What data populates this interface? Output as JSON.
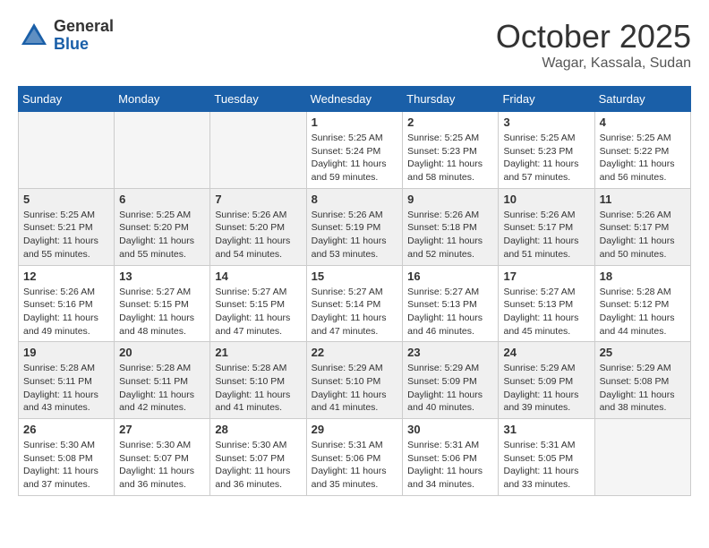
{
  "logo": {
    "general": "General",
    "blue": "Blue"
  },
  "title": "October 2025",
  "location": "Wagar, Kassala, Sudan",
  "days_header": [
    "Sunday",
    "Monday",
    "Tuesday",
    "Wednesday",
    "Thursday",
    "Friday",
    "Saturday"
  ],
  "weeks": [
    [
      {
        "day": "",
        "info": ""
      },
      {
        "day": "",
        "info": ""
      },
      {
        "day": "",
        "info": ""
      },
      {
        "day": "1",
        "info": "Sunrise: 5:25 AM\nSunset: 5:24 PM\nDaylight: 11 hours\nand 59 minutes."
      },
      {
        "day": "2",
        "info": "Sunrise: 5:25 AM\nSunset: 5:23 PM\nDaylight: 11 hours\nand 58 minutes."
      },
      {
        "day": "3",
        "info": "Sunrise: 5:25 AM\nSunset: 5:23 PM\nDaylight: 11 hours\nand 57 minutes."
      },
      {
        "day": "4",
        "info": "Sunrise: 5:25 AM\nSunset: 5:22 PM\nDaylight: 11 hours\nand 56 minutes."
      }
    ],
    [
      {
        "day": "5",
        "info": "Sunrise: 5:25 AM\nSunset: 5:21 PM\nDaylight: 11 hours\nand 55 minutes."
      },
      {
        "day": "6",
        "info": "Sunrise: 5:25 AM\nSunset: 5:20 PM\nDaylight: 11 hours\nand 55 minutes."
      },
      {
        "day": "7",
        "info": "Sunrise: 5:26 AM\nSunset: 5:20 PM\nDaylight: 11 hours\nand 54 minutes."
      },
      {
        "day": "8",
        "info": "Sunrise: 5:26 AM\nSunset: 5:19 PM\nDaylight: 11 hours\nand 53 minutes."
      },
      {
        "day": "9",
        "info": "Sunrise: 5:26 AM\nSunset: 5:18 PM\nDaylight: 11 hours\nand 52 minutes."
      },
      {
        "day": "10",
        "info": "Sunrise: 5:26 AM\nSunset: 5:17 PM\nDaylight: 11 hours\nand 51 minutes."
      },
      {
        "day": "11",
        "info": "Sunrise: 5:26 AM\nSunset: 5:17 PM\nDaylight: 11 hours\nand 50 minutes."
      }
    ],
    [
      {
        "day": "12",
        "info": "Sunrise: 5:26 AM\nSunset: 5:16 PM\nDaylight: 11 hours\nand 49 minutes."
      },
      {
        "day": "13",
        "info": "Sunrise: 5:27 AM\nSunset: 5:15 PM\nDaylight: 11 hours\nand 48 minutes."
      },
      {
        "day": "14",
        "info": "Sunrise: 5:27 AM\nSunset: 5:15 PM\nDaylight: 11 hours\nand 47 minutes."
      },
      {
        "day": "15",
        "info": "Sunrise: 5:27 AM\nSunset: 5:14 PM\nDaylight: 11 hours\nand 47 minutes."
      },
      {
        "day": "16",
        "info": "Sunrise: 5:27 AM\nSunset: 5:13 PM\nDaylight: 11 hours\nand 46 minutes."
      },
      {
        "day": "17",
        "info": "Sunrise: 5:27 AM\nSunset: 5:13 PM\nDaylight: 11 hours\nand 45 minutes."
      },
      {
        "day": "18",
        "info": "Sunrise: 5:28 AM\nSunset: 5:12 PM\nDaylight: 11 hours\nand 44 minutes."
      }
    ],
    [
      {
        "day": "19",
        "info": "Sunrise: 5:28 AM\nSunset: 5:11 PM\nDaylight: 11 hours\nand 43 minutes."
      },
      {
        "day": "20",
        "info": "Sunrise: 5:28 AM\nSunset: 5:11 PM\nDaylight: 11 hours\nand 42 minutes."
      },
      {
        "day": "21",
        "info": "Sunrise: 5:28 AM\nSunset: 5:10 PM\nDaylight: 11 hours\nand 41 minutes."
      },
      {
        "day": "22",
        "info": "Sunrise: 5:29 AM\nSunset: 5:10 PM\nDaylight: 11 hours\nand 41 minutes."
      },
      {
        "day": "23",
        "info": "Sunrise: 5:29 AM\nSunset: 5:09 PM\nDaylight: 11 hours\nand 40 minutes."
      },
      {
        "day": "24",
        "info": "Sunrise: 5:29 AM\nSunset: 5:09 PM\nDaylight: 11 hours\nand 39 minutes."
      },
      {
        "day": "25",
        "info": "Sunrise: 5:29 AM\nSunset: 5:08 PM\nDaylight: 11 hours\nand 38 minutes."
      }
    ],
    [
      {
        "day": "26",
        "info": "Sunrise: 5:30 AM\nSunset: 5:08 PM\nDaylight: 11 hours\nand 37 minutes."
      },
      {
        "day": "27",
        "info": "Sunrise: 5:30 AM\nSunset: 5:07 PM\nDaylight: 11 hours\nand 36 minutes."
      },
      {
        "day": "28",
        "info": "Sunrise: 5:30 AM\nSunset: 5:07 PM\nDaylight: 11 hours\nand 36 minutes."
      },
      {
        "day": "29",
        "info": "Sunrise: 5:31 AM\nSunset: 5:06 PM\nDaylight: 11 hours\nand 35 minutes."
      },
      {
        "day": "30",
        "info": "Sunrise: 5:31 AM\nSunset: 5:06 PM\nDaylight: 11 hours\nand 34 minutes."
      },
      {
        "day": "31",
        "info": "Sunrise: 5:31 AM\nSunset: 5:05 PM\nDaylight: 11 hours\nand 33 minutes."
      },
      {
        "day": "",
        "info": ""
      }
    ]
  ]
}
